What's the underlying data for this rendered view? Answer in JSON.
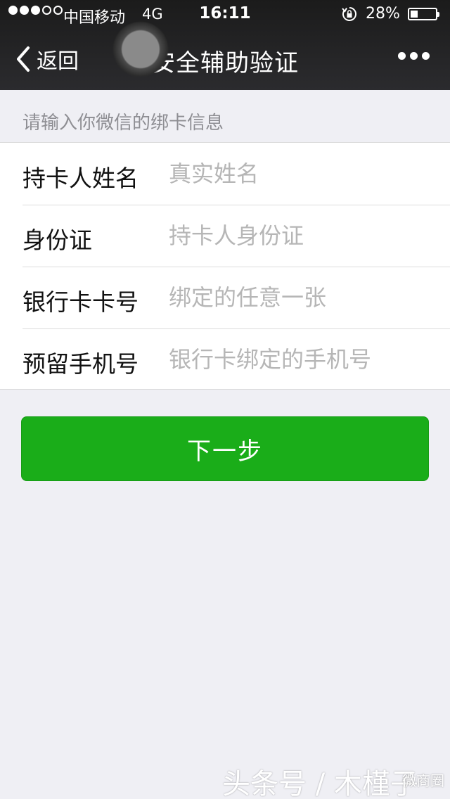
{
  "status_bar": {
    "signal_dots": [
      true,
      true,
      true,
      false,
      false
    ],
    "carrier": "中国移动",
    "network": "4G",
    "time": "16:11",
    "battery_percent_text": "28%",
    "battery_level": 0.28
  },
  "nav": {
    "back_label": "返回",
    "title": "安全辅助验证",
    "more_icon": "more-dots-icon"
  },
  "form": {
    "section_hint": "请输入你微信的绑卡信息",
    "fields": [
      {
        "label": "持卡人姓名",
        "placeholder": "真实姓名",
        "value": ""
      },
      {
        "label": "身份证",
        "placeholder": "持卡人身份证",
        "value": ""
      },
      {
        "label": "银行卡卡号",
        "placeholder": "绑定的任意一张",
        "value": ""
      },
      {
        "label": "预留手机号",
        "placeholder": "银行卡绑定的手机号",
        "value": ""
      }
    ]
  },
  "next_button": {
    "label": "下一步",
    "color": "#1aad19"
  },
  "watermark": {
    "text": "头条号 / 木槿子",
    "badge": "微商圈"
  },
  "colors": {
    "header_bg": "#222222",
    "page_bg": "#efeff4",
    "accent_green": "#1aad19"
  }
}
